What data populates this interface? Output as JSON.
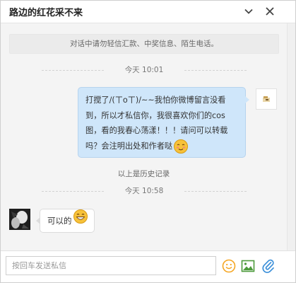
{
  "window": {
    "title": "路边的红花采不来",
    "collapse_icon": "chevron-down-icon",
    "close_icon": "close-icon"
  },
  "notice": "对话中请勿轻信汇款、中奖信息、陌生电话。",
  "messages": [
    {
      "time": "今天 10:01",
      "from": "me",
      "text": "打搅了/(ㄒoㄒ)/~~我怕你微博留言没看到，所以才私信你，我很喜欢你们的cos图，看的我春心荡漾！！！请问可以转载吗？会注明出处和作者哒",
      "emoji": "blush-emoji"
    }
  ],
  "history_note": "以上是历史记录",
  "messages_new": [
    {
      "time": "今天 10:58",
      "from": "other",
      "text": "可以的",
      "emoji": "grin-emoji"
    }
  ],
  "composer": {
    "placeholder": "按回车发送私信",
    "value": "",
    "icons": [
      "emoji-icon",
      "image-icon",
      "attachment-icon"
    ]
  },
  "colors": {
    "my_bubble": "#cfe6fa",
    "chat_background": "#f4f4f4",
    "icon_blue": "#3a8fd9",
    "emoji_yellow": "#f5b323",
    "image_green": "#4c9a3a"
  }
}
